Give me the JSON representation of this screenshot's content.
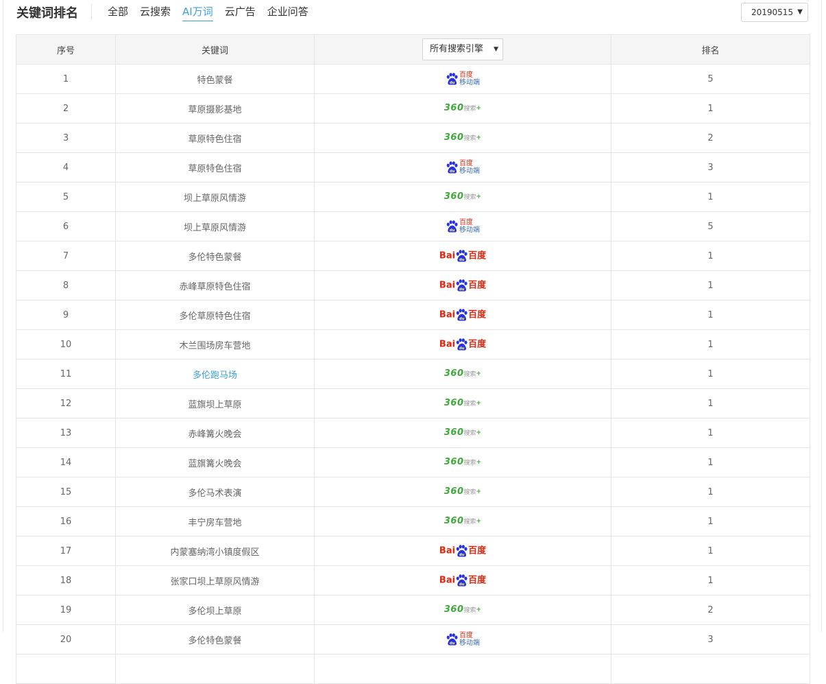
{
  "header": {
    "title": "关键词排名",
    "tabs": [
      {
        "label": "全部",
        "active": false
      },
      {
        "label": "云搜索",
        "active": false
      },
      {
        "label": "AI万词",
        "active": true
      },
      {
        "label": "云广告",
        "active": false
      },
      {
        "label": "企业问答",
        "active": false
      }
    ],
    "date_value": "20190515"
  },
  "table": {
    "columns": {
      "index": "序号",
      "keyword": "关键词",
      "engine_filter": "所有搜索引擎",
      "rank": "排名"
    },
    "rows": [
      {
        "index": "1",
        "keyword": "特色蒙餐",
        "engine": "baidu_mobile",
        "rank": "5"
      },
      {
        "index": "2",
        "keyword": "草原摄影基地",
        "engine": "360",
        "rank": "1"
      },
      {
        "index": "3",
        "keyword": "草原特色住宿",
        "engine": "360",
        "rank": "2"
      },
      {
        "index": "4",
        "keyword": "草原特色住宿",
        "engine": "baidu_mobile",
        "rank": "3"
      },
      {
        "index": "5",
        "keyword": "坝上草原风情游",
        "engine": "360",
        "rank": "1"
      },
      {
        "index": "6",
        "keyword": "坝上草原风情游",
        "engine": "baidu_mobile",
        "rank": "5"
      },
      {
        "index": "7",
        "keyword": "多伦特色蒙餐",
        "engine": "baidu",
        "rank": "1"
      },
      {
        "index": "8",
        "keyword": "赤峰草原特色住宿",
        "engine": "baidu",
        "rank": "1"
      },
      {
        "index": "9",
        "keyword": "多伦草原特色住宿",
        "engine": "baidu",
        "rank": "1"
      },
      {
        "index": "10",
        "keyword": "木兰围场房车营地",
        "engine": "baidu",
        "rank": "1"
      },
      {
        "index": "11",
        "keyword": "多伦跑马场",
        "engine": "360",
        "rank": "1",
        "highlight": true
      },
      {
        "index": "12",
        "keyword": "蓝旗坝上草原",
        "engine": "360",
        "rank": "1"
      },
      {
        "index": "13",
        "keyword": "赤峰篝火晚会",
        "engine": "360",
        "rank": "1"
      },
      {
        "index": "14",
        "keyword": "蓝旗篝火晚会",
        "engine": "360",
        "rank": "1"
      },
      {
        "index": "15",
        "keyword": "多伦马术表演",
        "engine": "360",
        "rank": "1"
      },
      {
        "index": "16",
        "keyword": "丰宁房车营地",
        "engine": "360",
        "rank": "1"
      },
      {
        "index": "17",
        "keyword": "内蒙塞纳湾小镇度假区",
        "engine": "baidu",
        "rank": "1"
      },
      {
        "index": "18",
        "keyword": "张家口坝上草原风情游",
        "engine": "baidu",
        "rank": "1"
      },
      {
        "index": "19",
        "keyword": "多伦坝上草原",
        "engine": "360",
        "rank": "2"
      },
      {
        "index": "20",
        "keyword": "多伦特色蒙餐",
        "engine": "baidu_mobile",
        "rank": "3"
      }
    ]
  },
  "logos": {
    "baidu": {
      "text_left": "Bai",
      "text_right": "百度",
      "color_red": "#de2910",
      "color_blue": "#2932e1"
    },
    "baidu_mobile": {
      "line1": "百度",
      "line2": "移动端",
      "color_red": "#de2910",
      "color_blue": "#2932e1",
      "color_line2": "#3b6fb6"
    },
    "360": {
      "text_main": "360",
      "text_sub": "搜索",
      "plus": "+",
      "color_green": "#3cab37",
      "color_sub": "#9a9a9a"
    }
  },
  "icons": {
    "paw": "paw-icon",
    "dropdown": "caret-down-icon"
  }
}
